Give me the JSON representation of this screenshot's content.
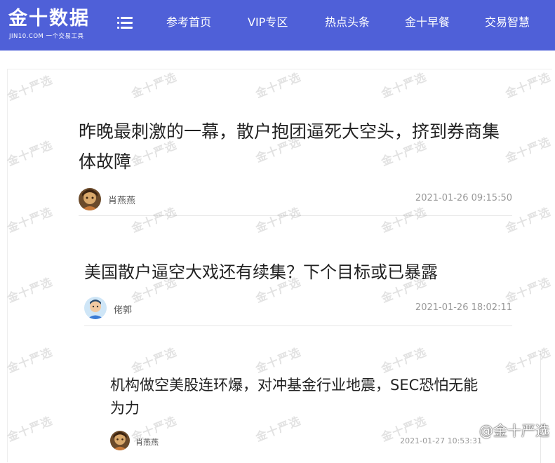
{
  "header": {
    "logo_text": "金十数据",
    "logo_subtext": "JIN10.COM 一个交易工具",
    "nav": [
      {
        "label": "参考首页"
      },
      {
        "label": "VIP专区"
      },
      {
        "label": "热点头条"
      },
      {
        "label": "金十早餐"
      },
      {
        "label": "交易智慧"
      }
    ]
  },
  "articles": [
    {
      "title": "昨晚最刺激的一幕，散户抱团逼死大空头，挤到券商集体故障",
      "author": "肖燕燕",
      "time": "2021-01-26 09:15:50"
    },
    {
      "title": "美国散户逼空大戏还有续集？下个目标或已暴露",
      "author": "佬郭",
      "time": "2021-01-26 18:02:11"
    },
    {
      "title": "机构做空美股连环爆，对冲基金行业地震，SEC恐怕无能为力",
      "author": "肖燕燕",
      "time": "2021-01-27 10:53:31"
    }
  ],
  "watermark_text": "金十严选",
  "credit": "@金十严选",
  "colors": {
    "header_bg": "#4f60d8",
    "title": "#222222",
    "meta": "#999999"
  }
}
